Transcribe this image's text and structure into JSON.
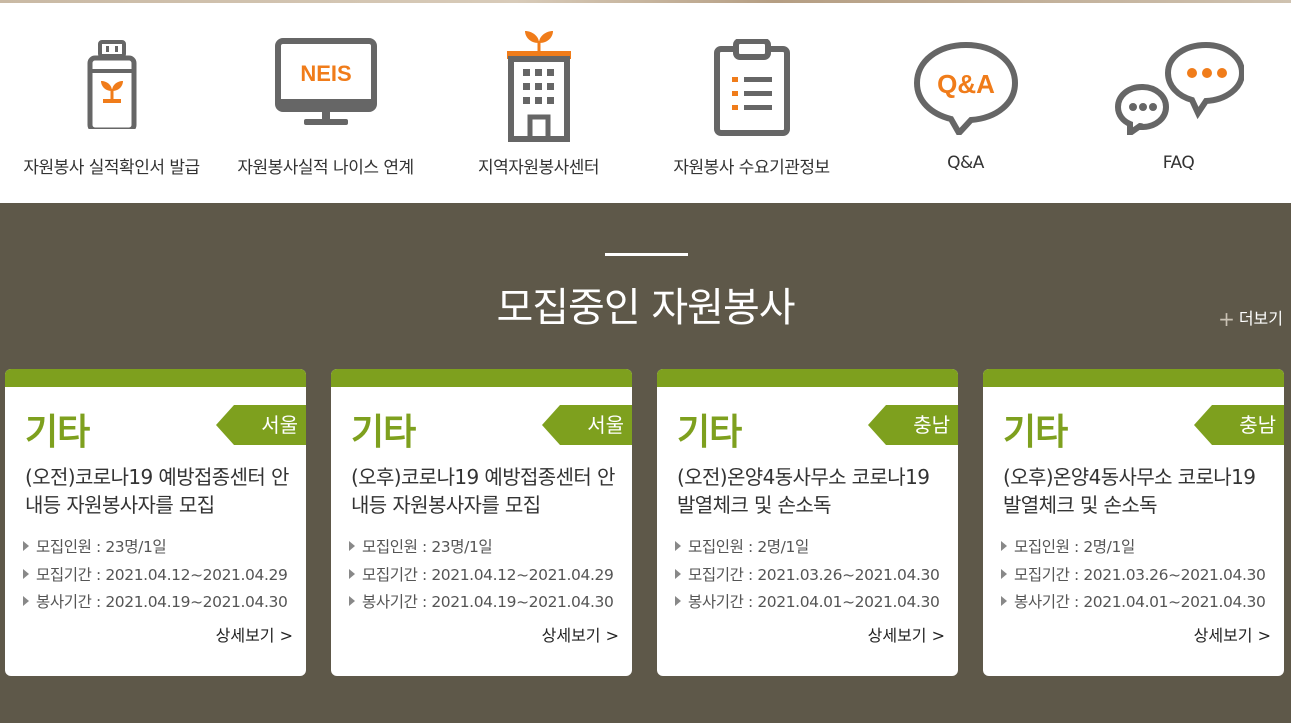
{
  "quick_menu": [
    {
      "label": "자원봉사 실적확인서 발급",
      "icon": "usb-certificate-icon"
    },
    {
      "label": "자원봉사실적 나이스 연계",
      "icon": "neis-monitor-icon",
      "icon_text": "NEIS"
    },
    {
      "label": "지역자원봉사센터",
      "icon": "building-sprout-icon"
    },
    {
      "label": "자원봉사 수요기관정보",
      "icon": "clipboard-list-icon"
    },
    {
      "label": "Q&A",
      "icon": "qa-bubble-icon",
      "icon_text": "Q&A"
    },
    {
      "label": "FAQ",
      "icon": "faq-bubbles-icon"
    }
  ],
  "section": {
    "title": "모집중인 자원봉사",
    "more_label": "더보기"
  },
  "cards": [
    {
      "category": "기타",
      "region": "서울",
      "title": "(오전)코로나19 예방접종센터 안내등 자원봉사자를 모집",
      "members_label": "모집인원",
      "members": ": 23명/1일",
      "period_label": "모집기간",
      "period": ": 2021.04.12~2021.04.29",
      "service_label": "봉사기간",
      "service": ": 2021.04.19~2021.04.30",
      "detail": "상세보기 >"
    },
    {
      "category": "기타",
      "region": "서울",
      "title": "(오후)코로나19 예방접종센터 안내등 자원봉사자를 모집",
      "members_label": "모집인원",
      "members": ": 23명/1일",
      "period_label": "모집기간",
      "period": ": 2021.04.12~2021.04.29",
      "service_label": "봉사기간",
      "service": ": 2021.04.19~2021.04.30",
      "detail": "상세보기 >"
    },
    {
      "category": "기타",
      "region": "충남",
      "title": "(오전)온양4동사무소 코로나19 발열체크 및 손소독",
      "members_label": "모집인원",
      "members": ": 2명/1일",
      "period_label": "모집기간",
      "period": ": 2021.03.26~2021.04.30",
      "service_label": "봉사기간",
      "service": ": 2021.04.01~2021.04.30",
      "detail": "상세보기 >"
    },
    {
      "category": "기타",
      "region": "충남",
      "title": "(오후)온양4동사무소 코로나19 발열체크 및 손소독",
      "members_label": "모집인원",
      "members": ": 2명/1일",
      "period_label": "모집기간",
      "period": ": 2021.03.26~2021.04.30",
      "service_label": "봉사기간",
      "service": ": 2021.04.01~2021.04.30",
      "detail": "상세보기 >"
    }
  ],
  "colors": {
    "accent_green": "#7ea01e",
    "icon_orange": "#f07c1a",
    "icon_gray": "#666666",
    "section_bg": "#5e5849"
  }
}
